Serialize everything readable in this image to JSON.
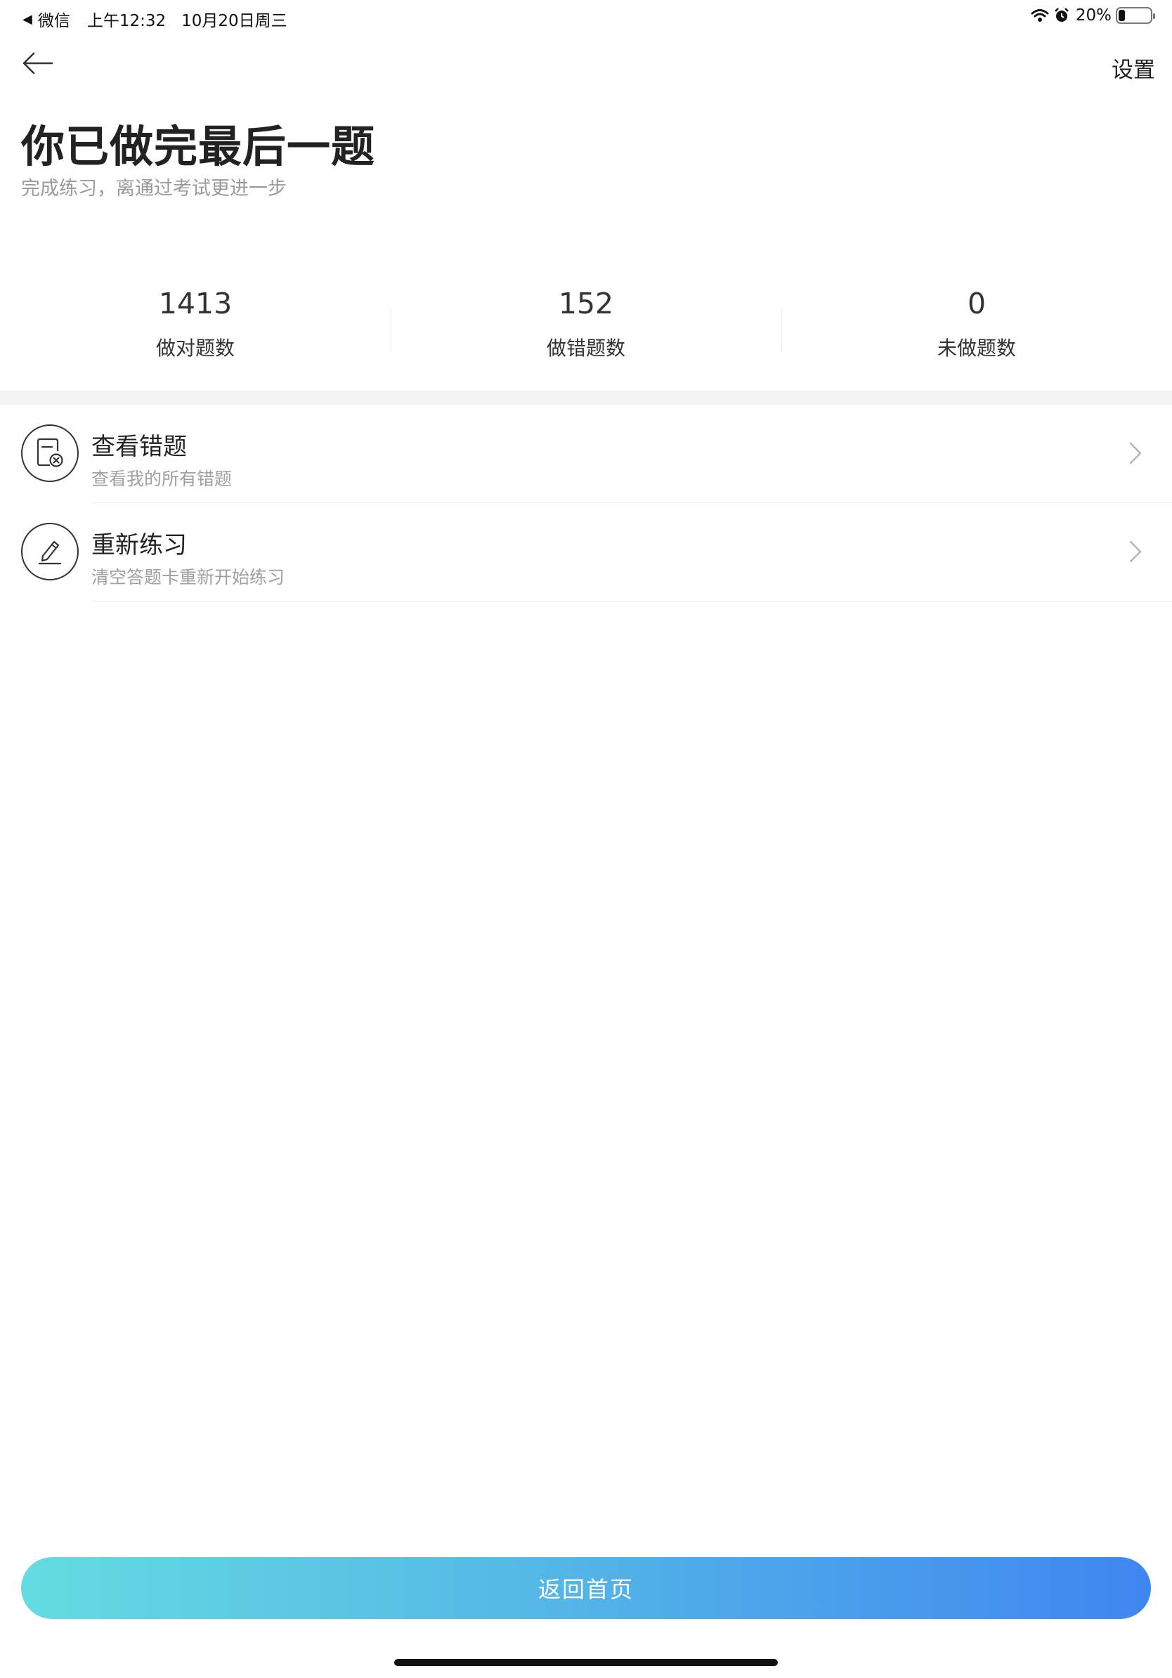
{
  "status_bar": {
    "back_app": "微信",
    "time": "上午12:32",
    "date": "10月20日周三",
    "battery": "20%",
    "battery_level": 0.2
  },
  "nav": {
    "back_icon": "arrow-left-icon",
    "settings_label": "设置"
  },
  "header": {
    "title": "你已做完最后一题",
    "subtitle": "完成练习，离通过考试更进一步"
  },
  "stats": [
    {
      "value": "1413",
      "label": "做对题数"
    },
    {
      "value": "152",
      "label": "做错题数"
    },
    {
      "value": "0",
      "label": "未做题数"
    }
  ],
  "actions": [
    {
      "title": "查看错题",
      "desc": "查看我的所有错题",
      "icon": "wrong-questions-icon"
    },
    {
      "title": "重新练习",
      "desc": "清空答题卡重新开始练习",
      "icon": "edit-pen-icon"
    }
  ],
  "footer": {
    "home_button_label": "返回首页"
  },
  "colors": {
    "gradient_start": "#64dce2",
    "gradient_end": "#3f86f0",
    "subtitle_gray": "#9a9a9a"
  }
}
